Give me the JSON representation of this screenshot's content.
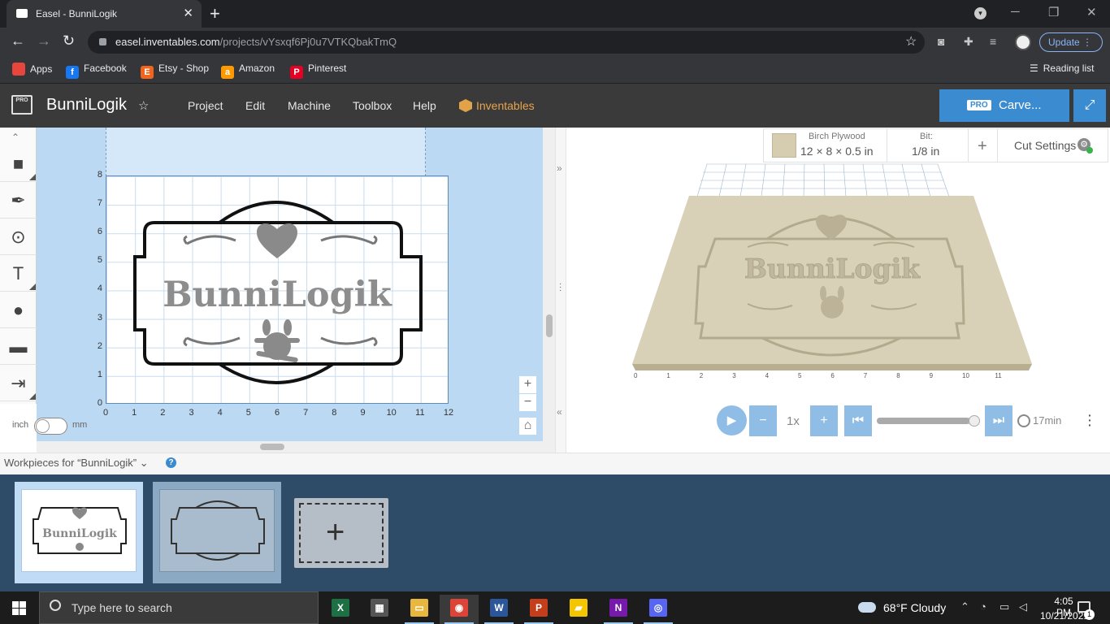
{
  "browser": {
    "tab_title": "Easel - BunniLogik",
    "new_tab": "+",
    "url_host": "easel.inventables.com",
    "url_path": "/projects/vYsxqf6Pj0u7VTKQbakTmQ",
    "update_label": "Update",
    "reading_list": "Reading list",
    "bookmarks": [
      {
        "label": "Apps",
        "icon": "apps-grid-icon",
        "color": "#e8453c"
      },
      {
        "label": "Facebook",
        "icon": "facebook-icon",
        "glyph": "f",
        "color": "#1877f2"
      },
      {
        "label": "Etsy - Shop",
        "icon": "etsy-icon",
        "glyph": "E",
        "color": "#f1641e"
      },
      {
        "label": "Amazon",
        "icon": "amazon-icon",
        "glyph": "a",
        "color": "#ff9900"
      },
      {
        "label": "Pinterest",
        "icon": "pinterest-icon",
        "glyph": "P",
        "color": "#e60023"
      }
    ]
  },
  "app": {
    "logo_text": "PRO",
    "project_name": "BunniLogik",
    "menu": [
      "Project",
      "Edit",
      "Machine",
      "Toolbox",
      "Help"
    ],
    "inventables_label": "Inventables",
    "carve_pro": "PRO",
    "carve_label": "Carve...",
    "accent": "#3b8bd0"
  },
  "tools": [
    {
      "name": "shapes-tool-icon",
      "glyph": "■"
    },
    {
      "name": "pen-tool-icon",
      "glyph": "✒"
    },
    {
      "name": "point-tool-icon",
      "glyph": "⊙"
    },
    {
      "name": "text-tool-icon",
      "glyph": "T"
    },
    {
      "name": "icons-tool-icon",
      "glyph": "●"
    },
    {
      "name": "apps-tool-icon",
      "glyph": "▬"
    },
    {
      "name": "import-tool-icon",
      "glyph": "⇥"
    }
  ],
  "canvas": {
    "y_ticks": [
      "8",
      "7",
      "6",
      "5",
      "4",
      "3",
      "2",
      "1",
      "0"
    ],
    "x_ticks": [
      "0",
      "1",
      "2",
      "3",
      "4",
      "5",
      "6",
      "7",
      "8",
      "9",
      "10",
      "11",
      "12"
    ],
    "design_text": "BunniLogik",
    "unit_left": "inch",
    "unit_right": "mm",
    "zoom_in": "+",
    "zoom_out": "−",
    "home": "⌂"
  },
  "material": {
    "name": "Birch Plywood",
    "dims": "12 × 8 × 0.5 in",
    "bit_label": "Bit:",
    "bit_value": "1/8 in",
    "add_bit": "+",
    "cut_settings": "Cut Settings",
    "swatch_color": "#d6ccaf"
  },
  "preview": {
    "x_ticks": [
      "0",
      "1",
      "2",
      "3",
      "4",
      "5",
      "6",
      "7",
      "8",
      "9",
      "10",
      "11"
    ],
    "carved_text": "BunniLogik"
  },
  "playback": {
    "speed": "1x",
    "duration": "17min",
    "progress": 0.95
  },
  "workpieces": {
    "title": "Workpieces for “BunniLogik”",
    "chevron": "⌄",
    "help": "?",
    "thumb_text": "BunniLogik"
  },
  "taskbar": {
    "search_placeholder": "Type here to search",
    "apps": [
      {
        "name": "excel-app",
        "glyph": "X",
        "color": "#1d7044"
      },
      {
        "name": "calculator-app",
        "glyph": "▦",
        "color": "#555555"
      },
      {
        "name": "file-explorer-app",
        "glyph": "▭",
        "color": "#e8b73e"
      },
      {
        "name": "chrome-app",
        "glyph": "◉",
        "color": "#db4437"
      },
      {
        "name": "word-app",
        "glyph": "W",
        "color": "#2b579a"
      },
      {
        "name": "powerpoint-app",
        "glyph": "P",
        "color": "#c43e1c"
      },
      {
        "name": "sticky-notes-app",
        "glyph": "▰",
        "color": "#f3c600"
      },
      {
        "name": "onenote-app",
        "glyph": "N",
        "color": "#7719aa"
      },
      {
        "name": "discord-app",
        "glyph": "◎",
        "color": "#5865f2"
      }
    ],
    "weather": "68°F  Cloudy",
    "time": "4:05 PM",
    "date": "10/21/2021",
    "notifications": "1"
  }
}
